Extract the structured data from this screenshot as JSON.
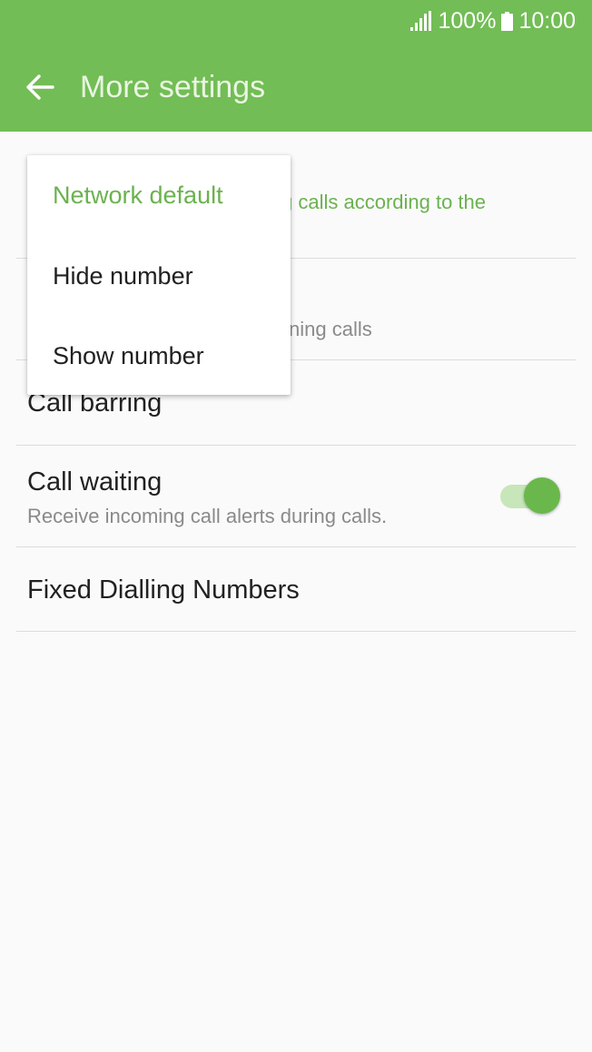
{
  "status_bar": {
    "signal_icon": "signal-icon",
    "battery_percent": "100%",
    "battery_icon": "battery-icon",
    "time": "10:00"
  },
  "header": {
    "back_icon": "arrow-left-icon",
    "title": "More settings"
  },
  "settings": {
    "caller_id_sub_visible": "g calls according to the",
    "hidden_item_sub_visible": "ning calls",
    "call_barring": "Call barring",
    "call_waiting": {
      "title": "Call waiting",
      "subtitle": "Receive incoming call alerts during calls.",
      "enabled": true
    },
    "fixed_dialling": "Fixed Dialling Numbers"
  },
  "popup_menu": {
    "options": [
      "Network default",
      "Hide number",
      "Show number"
    ],
    "selected": "Network default"
  },
  "colors": {
    "appbar": "#72bd55",
    "accent": "#6bb24f",
    "background": "#fafafa"
  }
}
